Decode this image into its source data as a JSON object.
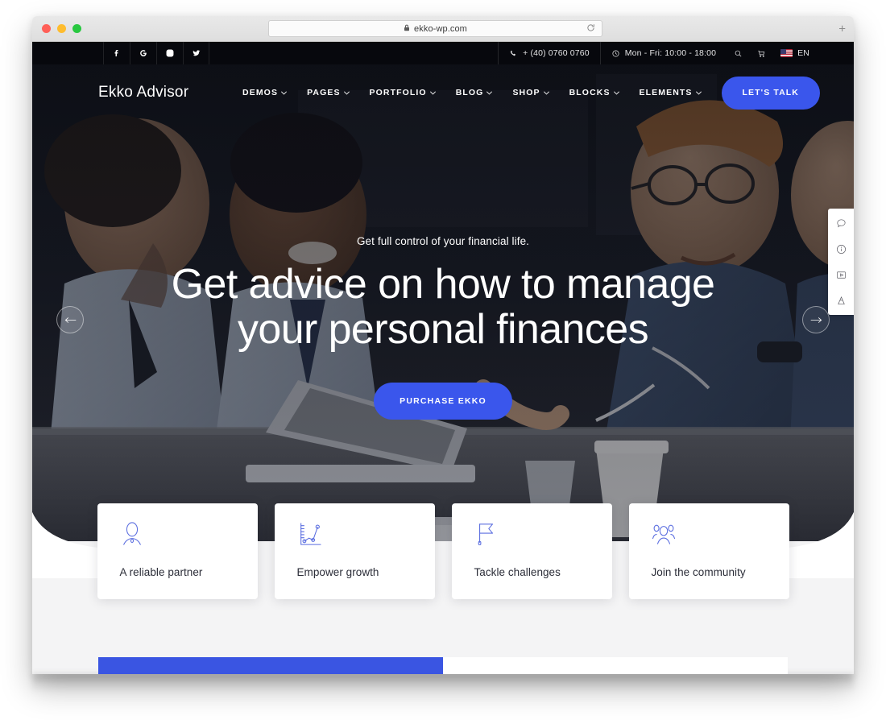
{
  "browser": {
    "url": "ekko-wp.com",
    "lock_icon": "lock-icon",
    "reload_icon": "reload-icon",
    "new_tab_label": "+",
    "traffic_lights": [
      "close-red",
      "minimize-yellow",
      "maximize-green"
    ]
  },
  "topbar": {
    "social": [
      {
        "name": "facebook-icon",
        "label": "Facebook"
      },
      {
        "name": "google-icon",
        "label": "Google"
      },
      {
        "name": "instagram-icon",
        "label": "Instagram"
      },
      {
        "name": "twitter-icon",
        "label": "Twitter"
      }
    ],
    "phone": "+ (40) 0760 0760",
    "hours": "Mon - Fri: 10:00 - 18:00",
    "search_icon": "search-icon",
    "cart_icon": "cart-icon",
    "language": "EN",
    "flag": "us-flag"
  },
  "nav": {
    "logo": "Ekko Advisor",
    "items": [
      {
        "label": "DEMOS",
        "has_dropdown": true
      },
      {
        "label": "PAGES",
        "has_dropdown": true
      },
      {
        "label": "PORTFOLIO",
        "has_dropdown": true
      },
      {
        "label": "BLOG",
        "has_dropdown": true
      },
      {
        "label": "SHOP",
        "has_dropdown": true
      },
      {
        "label": "BLOCKS",
        "has_dropdown": true
      },
      {
        "label": "ELEMENTS",
        "has_dropdown": true
      }
    ],
    "cta_label": "LET'S TALK",
    "cta_color": "#3a56ec"
  },
  "hero": {
    "subtitle": "Get full control of your financial life.",
    "title_line1": "Get advice on how to manage",
    "title_line2": "your personal finances",
    "button_label": "PURCHASE EKKO",
    "button_color": "#3a56ec",
    "prev_arrow": "arrow-left-icon",
    "next_arrow": "arrow-right-icon"
  },
  "side_tools": [
    {
      "name": "chat-bubble-icon",
      "label": "Chat"
    },
    {
      "name": "info-circle-icon",
      "label": "Info"
    },
    {
      "name": "video-play-icon",
      "label": "Video"
    },
    {
      "name": "bag-icon",
      "label": "Shop"
    }
  ],
  "features": [
    {
      "icon": "person-icon",
      "label": "A reliable partner"
    },
    {
      "icon": "growth-chart-icon",
      "label": "Empower growth"
    },
    {
      "icon": "flag-icon",
      "label": "Tackle challenges"
    },
    {
      "icon": "community-icon",
      "label": "Join the community"
    }
  ],
  "lower_band": {
    "blue_color": "#3a55e2",
    "brick_color": "#f0f0f2"
  }
}
